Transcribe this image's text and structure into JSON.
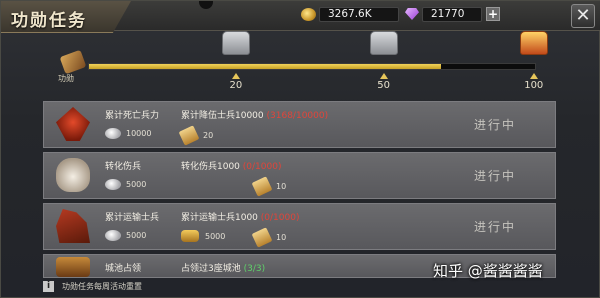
{
  "window": {
    "title": "功勋任务",
    "close_label": "✕"
  },
  "resources": {
    "gold": {
      "value": "3267.6K",
      "icon": "gold-ingot-icon"
    },
    "gems": {
      "value": "21770",
      "icon": "purple-gem-icon",
      "plus_label": "+"
    }
  },
  "progress": {
    "start_label": "功勋",
    "fill_fraction": 0.79,
    "milestones": [
      {
        "label": "20",
        "fraction": 0.33,
        "chest": "silver-chest-icon"
      },
      {
        "label": "50",
        "fraction": 0.66,
        "chest": "silver-chest-icon"
      },
      {
        "label": "100",
        "fraction": 0.995,
        "chest": "gold-chest-icon"
      }
    ]
  },
  "quests": [
    {
      "title": "累计死亡兵力",
      "condition": "累计降伍士兵10000",
      "progress": "(3168/10000)",
      "progress_color": "red",
      "reward1": "10000",
      "reward2": "20",
      "status": "进行中"
    },
    {
      "title": "转化伤兵",
      "condition": "转化伤兵1000",
      "progress": "(0/1000)",
      "progress_color": "red",
      "reward1": "5000",
      "reward2": "10",
      "status": "进行中"
    },
    {
      "title": "累计运输士兵",
      "condition": "累计运输士兵1000",
      "progress": "(0/1000)",
      "progress_color": "red",
      "reward1": "5000",
      "reward2": "5000",
      "reward3": "10",
      "status": "进行中"
    },
    {
      "title": "城池占领",
      "condition": "占领过3座城池",
      "progress": "(3/3)",
      "progress_color": "green",
      "status": ""
    }
  ],
  "footer": {
    "text": "功勋任务每周活动重置"
  },
  "watermark": "知乎 @酱酱酱酱",
  "colors": {
    "progress_fill": "#e0c23e",
    "progress_red": "#e0453a",
    "progress_green": "#5fd06a"
  }
}
